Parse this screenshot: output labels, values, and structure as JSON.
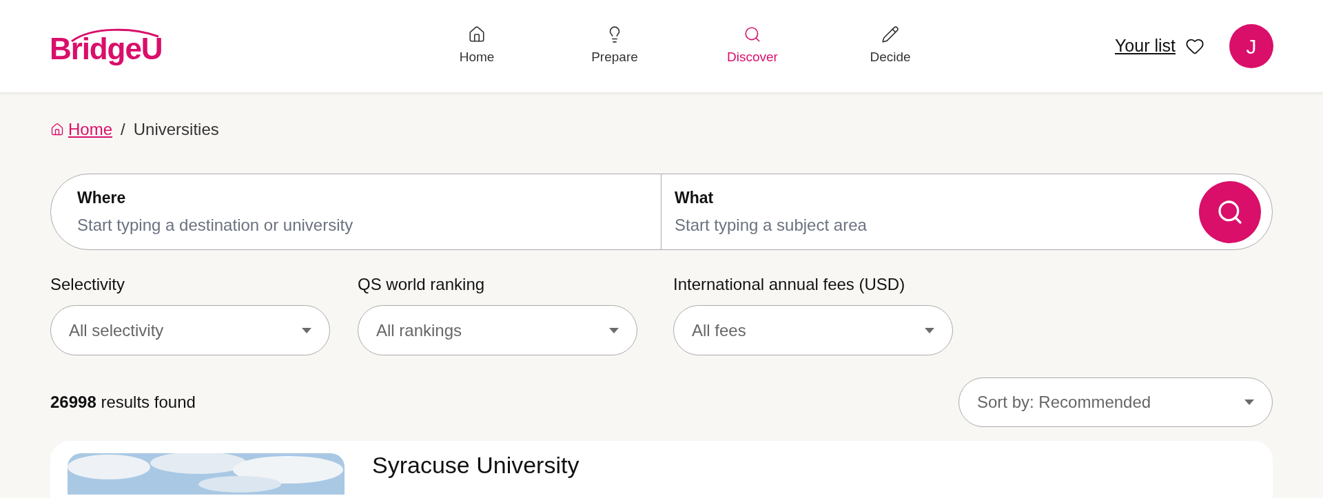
{
  "header": {
    "logo": "BridgeU",
    "nav": [
      {
        "label": "Home",
        "selected": false
      },
      {
        "label": "Prepare",
        "selected": false
      },
      {
        "label": "Discover",
        "selected": true
      },
      {
        "label": "Decide",
        "selected": false
      }
    ],
    "your_list": "Your list",
    "avatar": "J"
  },
  "breadcrumb": {
    "home": "Home",
    "separator": "/",
    "current": "Universities"
  },
  "search": {
    "where": {
      "label": "Where",
      "placeholder": "Start typing a destination or university"
    },
    "what": {
      "label": "What",
      "placeholder": "Start typing a subject area"
    }
  },
  "filters": [
    {
      "label": "Selectivity",
      "value": "All selectivity"
    },
    {
      "label": "QS world ranking",
      "value": "All rankings"
    },
    {
      "label": "International annual fees (USD)",
      "value": "All fees"
    }
  ],
  "results": {
    "count": "26998",
    "text": "results found"
  },
  "sort": {
    "value": "Sort by: Recommended"
  },
  "first_result": {
    "name": "Syracuse University"
  }
}
